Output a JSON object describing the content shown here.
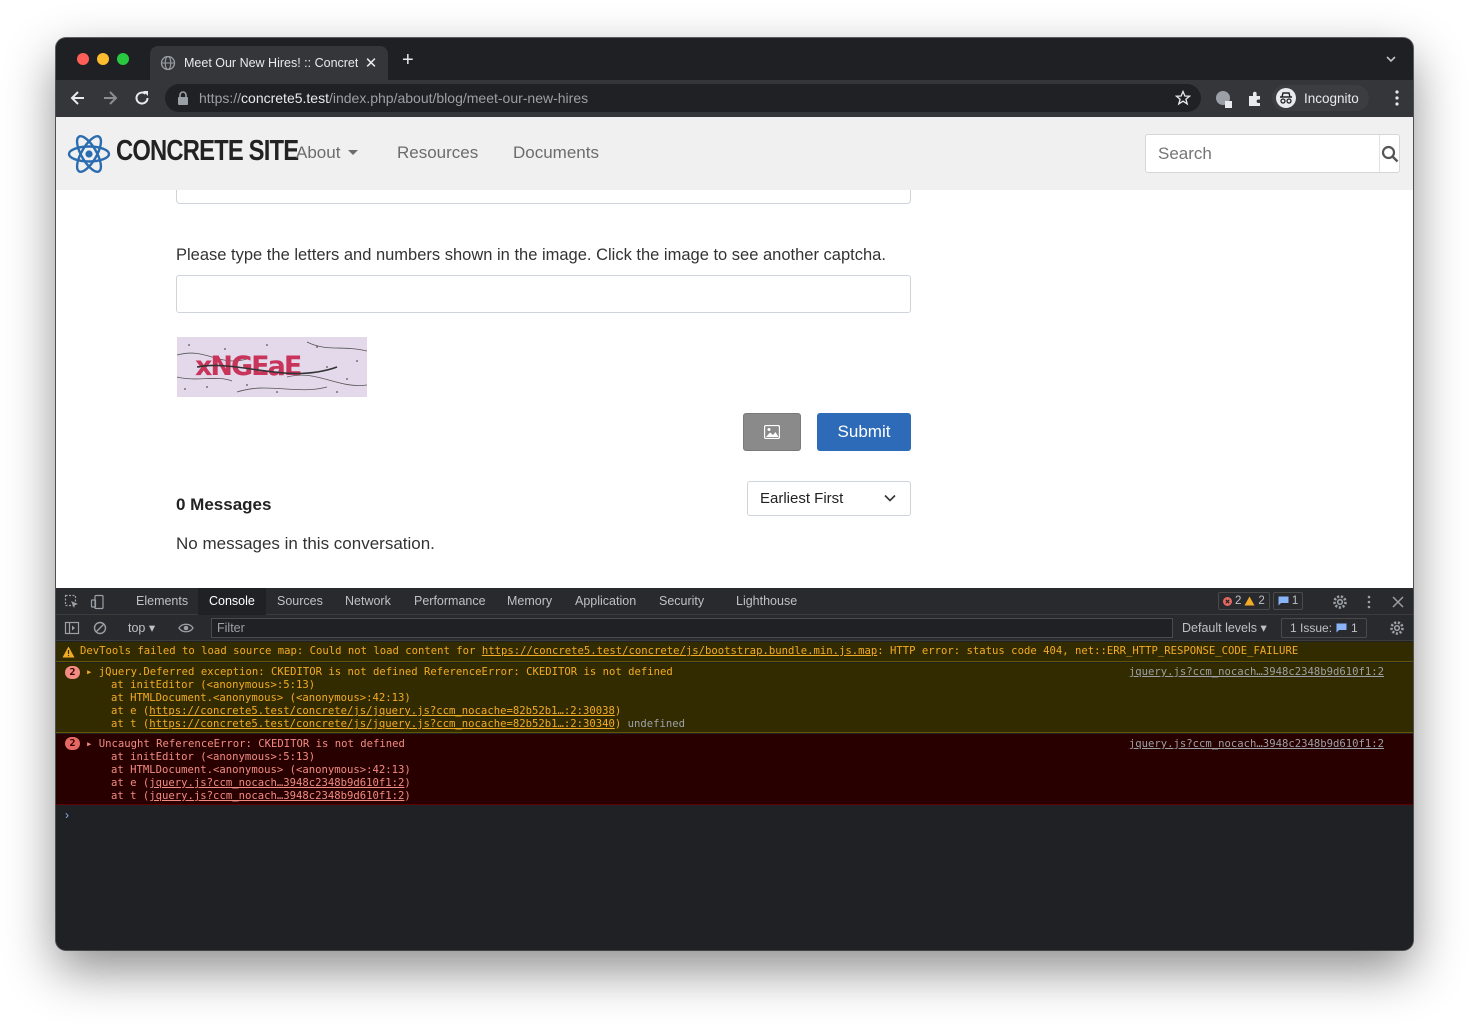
{
  "browser": {
    "tab_title": "Meet Our New Hires! :: Concrete Site",
    "url_scheme": "https://",
    "url_host": "concrete5.test",
    "url_path": "/index.php/about/blog/meet-our-new-hires",
    "profile_label": "Incognito"
  },
  "site": {
    "logo_text": "CONCRETE SITE",
    "nav": [
      "About",
      "Resources",
      "Documents"
    ],
    "search_placeholder": "Search",
    "captcha_help": "Please type the letters and numbers shown in the image. Click the image to see another captcha.",
    "captcha_text": "xNGEaE",
    "submit_label": "Submit",
    "messages_count": "0 Messages",
    "sort_value": "Earliest First",
    "no_messages": "No messages in this conversation."
  },
  "devtools": {
    "tabs": [
      "Elements",
      "Console",
      "Sources",
      "Network",
      "Performance",
      "Memory",
      "Application",
      "Security",
      "Lighthouse"
    ],
    "active_tab": "Console",
    "error_count": "2",
    "warning_count": "2",
    "info_count": "1",
    "context": "top",
    "filter_placeholder": "Filter",
    "levels": "Default levels",
    "issues_label": "1 Issue:",
    "issues_count": "1",
    "warning": {
      "prefix": "DevTools failed to load source map: Could not load content for ",
      "url": "https://concrete5.test/concrete/js/bootstrap.bundle.min.js.map",
      "suffix": ": HTTP error: status code 404, net::ERR_HTTP_RESPONSE_CODE_FAILURE"
    },
    "error1": {
      "count": "2",
      "message": "jQuery.Deferred exception: CKEDITOR is not defined ReferenceError: CKEDITOR is not defined",
      "source": "jquery.js?ccm_nocach…3948c2348b9d610f1:2",
      "stack0": "at initEditor (<anonymous>:5:13)",
      "stack1": "at HTMLDocument.<anonymous> (<anonymous>:42:13)",
      "stack2_pre": "at e (",
      "stack2_link": "https://concrete5.test/concrete/js/jquery.js?ccm_nocache=82b52b1…:2:30038",
      "stack3_pre": "at t (",
      "stack3_link": "https://concrete5.test/concrete/js/jquery.js?ccm_nocache=82b52b1…:2:30340",
      "stack3_suffix": "undefined"
    },
    "error2": {
      "count": "2",
      "message": "Uncaught ReferenceError: CKEDITOR is not defined",
      "source": "jquery.js?ccm_nocach…3948c2348b9d610f1:2",
      "stack0": "at initEditor (<anonymous>:5:13)",
      "stack1": "at HTMLDocument.<anonymous> (<anonymous>:42:13)",
      "stack2_pre": "at e (",
      "stack2_link": "jquery.js?ccm_nocach…3948c2348b9d610f1:2",
      "stack3_pre": "at t (",
      "stack3_link": "jquery.js?ccm_nocach…3948c2348b9d610f1:2"
    }
  }
}
